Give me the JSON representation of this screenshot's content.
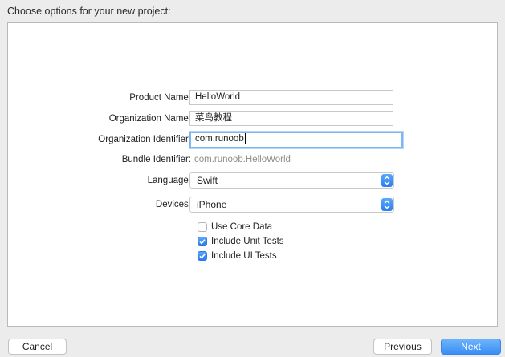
{
  "header": {
    "title": "Choose options for your new project:"
  },
  "form": {
    "product_name": {
      "label": "Product Name:",
      "value": "HelloWorld"
    },
    "organization_name": {
      "label": "Organization Name:",
      "value": "菜鸟教程"
    },
    "organization_identifier": {
      "label": "Organization Identifier:",
      "value": "com.runoob"
    },
    "bundle_identifier": {
      "label": "Bundle Identifier:",
      "value": "com.runoob.HelloWorld"
    },
    "language": {
      "label": "Language:",
      "value": "Swift"
    },
    "devices": {
      "label": "Devices:",
      "value": "iPhone"
    },
    "options": [
      {
        "label": "Use Core Data",
        "checked": false
      },
      {
        "label": "Include Unit Tests",
        "checked": true
      },
      {
        "label": "Include UI Tests",
        "checked": true
      }
    ]
  },
  "footer": {
    "cancel_label": "Cancel",
    "previous_label": "Previous",
    "next_label": "Next"
  },
  "colors": {
    "accent": "#2b7ef0",
    "background": "#ececec",
    "panel": "#ffffff"
  },
  "icons": {
    "select_arrows": "up-down-chevron-icon",
    "checkmark": "checkmark-icon"
  }
}
